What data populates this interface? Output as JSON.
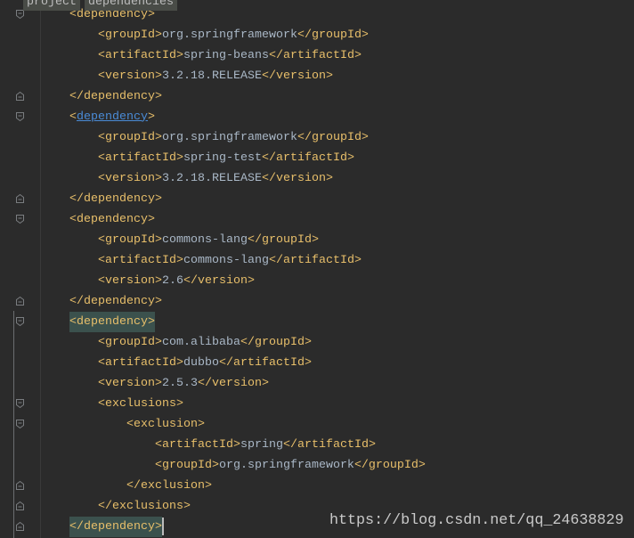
{
  "breadcrumb": {
    "items": [
      "project",
      "dependencies"
    ]
  },
  "editor": {
    "lines": [
      {
        "fold_icon": "fold-start-icon",
        "tokens": [
          {
            "ws": "    "
          },
          {
            "tag": "<dependency>"
          }
        ]
      },
      {
        "tokens": [
          {
            "ws": "        "
          },
          {
            "tag": "<groupId>"
          },
          {
            "text": "org.springframework"
          },
          {
            "tag": "</groupId>"
          }
        ]
      },
      {
        "tokens": [
          {
            "ws": "        "
          },
          {
            "tag": "<artifactId>"
          },
          {
            "text": "spring-beans"
          },
          {
            "tag": "</artifactId>"
          }
        ]
      },
      {
        "tokens": [
          {
            "ws": "        "
          },
          {
            "tag": "<version>"
          },
          {
            "text": "3.2.18.RELEASE"
          },
          {
            "tag": "</version>"
          }
        ]
      },
      {
        "fold_icon": "fold-end-icon",
        "tokens": [
          {
            "ws": "    "
          },
          {
            "tag": "</dependency>"
          }
        ]
      },
      {
        "fold_icon": "fold-start-icon",
        "tokens": [
          {
            "ws": "    "
          },
          {
            "tag": "<"
          },
          {
            "link": "dependency"
          },
          {
            "tag": ">"
          }
        ]
      },
      {
        "tokens": [
          {
            "ws": "        "
          },
          {
            "tag": "<groupId>"
          },
          {
            "text": "org.springframework"
          },
          {
            "tag": "</groupId>"
          }
        ]
      },
      {
        "tokens": [
          {
            "ws": "        "
          },
          {
            "tag": "<artifactId>"
          },
          {
            "text": "spring-test"
          },
          {
            "tag": "</artifactId>"
          }
        ]
      },
      {
        "tokens": [
          {
            "ws": "        "
          },
          {
            "tag": "<version>"
          },
          {
            "text": "3.2.18.RELEASE"
          },
          {
            "tag": "</version>"
          }
        ]
      },
      {
        "fold_icon": "fold-end-icon",
        "tokens": [
          {
            "ws": "    "
          },
          {
            "tag": "</dependency>"
          }
        ]
      },
      {
        "fold_icon": "fold-start-icon",
        "tokens": [
          {
            "ws": "    "
          },
          {
            "tag": "<dependency>"
          }
        ]
      },
      {
        "tokens": [
          {
            "ws": "        "
          },
          {
            "tag": "<groupId>"
          },
          {
            "text": "commons-lang"
          },
          {
            "tag": "</groupId>"
          }
        ]
      },
      {
        "tokens": [
          {
            "ws": "        "
          },
          {
            "tag": "<artifactId>"
          },
          {
            "text": "commons-lang"
          },
          {
            "tag": "</artifactId>"
          }
        ]
      },
      {
        "tokens": [
          {
            "ws": "        "
          },
          {
            "tag": "<version>"
          },
          {
            "text": "2.6"
          },
          {
            "tag": "</version>"
          }
        ]
      },
      {
        "fold_icon": "fold-end-icon",
        "tokens": [
          {
            "ws": "    "
          },
          {
            "tag": "</dependency>"
          }
        ]
      },
      {
        "fold_icon": "fold-start-icon",
        "tokens": [
          {
            "ws": "    "
          },
          {
            "matched_tag": "<dependency>"
          }
        ]
      },
      {
        "tokens": [
          {
            "ws": "        "
          },
          {
            "tag": "<groupId>"
          },
          {
            "text": "com.alibaba"
          },
          {
            "tag": "</groupId>"
          }
        ]
      },
      {
        "tokens": [
          {
            "ws": "        "
          },
          {
            "tag": "<artifactId>"
          },
          {
            "text": "dubbo"
          },
          {
            "tag": "</artifactId>"
          }
        ]
      },
      {
        "tokens": [
          {
            "ws": "        "
          },
          {
            "tag": "<version>"
          },
          {
            "text": "2.5.3"
          },
          {
            "tag": "</version>"
          }
        ]
      },
      {
        "fold_icon": "fold-start-icon",
        "tokens": [
          {
            "ws": "        "
          },
          {
            "tag": "<exclusions>"
          }
        ]
      },
      {
        "fold_icon": "fold-start-icon",
        "tokens": [
          {
            "ws": "            "
          },
          {
            "tag": "<exclusion>"
          }
        ]
      },
      {
        "tokens": [
          {
            "ws": "                "
          },
          {
            "tag": "<artifactId>"
          },
          {
            "text": "spring"
          },
          {
            "tag": "</artifactId>"
          }
        ]
      },
      {
        "tokens": [
          {
            "ws": "                "
          },
          {
            "tag": "<groupId>"
          },
          {
            "text": "org.springframework"
          },
          {
            "tag": "</groupId>"
          }
        ]
      },
      {
        "fold_icon": "fold-end-icon",
        "tokens": [
          {
            "ws": "            "
          },
          {
            "tag": "</exclusion>"
          }
        ]
      },
      {
        "fold_icon": "fold-end-icon",
        "tokens": [
          {
            "ws": "        "
          },
          {
            "tag": "</exclusions>"
          }
        ]
      },
      {
        "fold_icon": "fold-end-icon",
        "caret": true,
        "tokens": [
          {
            "ws": "    "
          },
          {
            "matched_tag": "</dependency>"
          }
        ]
      }
    ]
  },
  "watermark": "https://blog.csdn.net/qq_24638829",
  "theme": {
    "background": "#2B2B2B",
    "tag": "#E8BF6A",
    "text": "#A9B7C6",
    "link": "#4A8BD6",
    "matched_tag_bg": "#3B514D",
    "breadcrumb_bg": "#494C47",
    "breadcrumb_text": "#BDBDBD",
    "caret": "#BBBBBB",
    "fold_marker": "#7A7D80",
    "gutter_separator": "#3A3A3A",
    "scope_line": "#6B6E70",
    "watermark": "#CACACA"
  }
}
